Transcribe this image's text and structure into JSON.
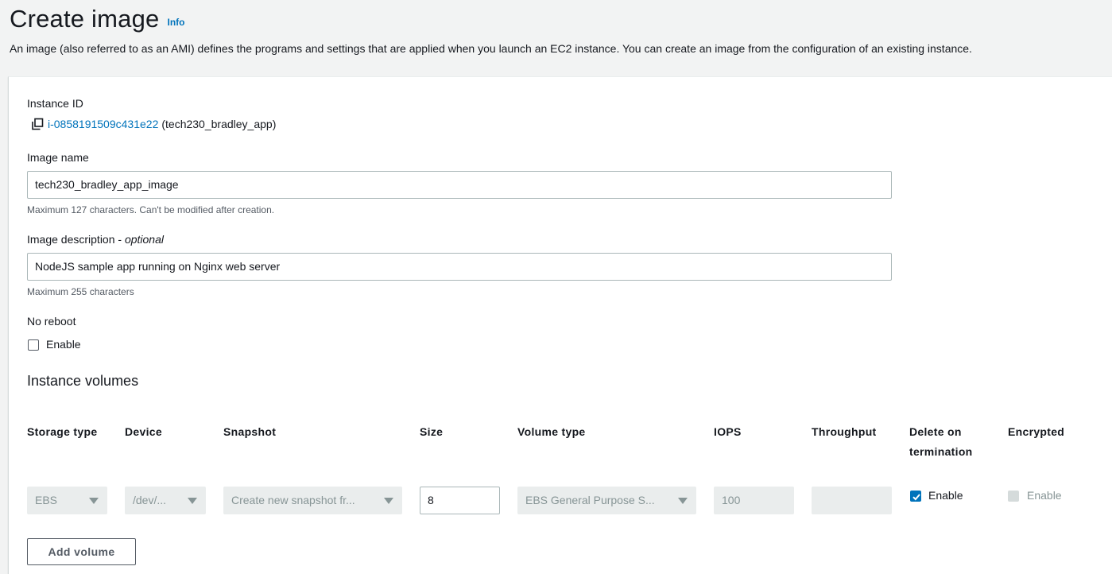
{
  "header": {
    "title": "Create image",
    "info_label": "Info",
    "description": "An image (also referred to as an AMI) defines the programs and settings that are applied when you launch an EC2 instance. You can create an image from the configuration of an existing instance."
  },
  "form": {
    "instance_id": {
      "label": "Instance ID",
      "id": "i-0858191509c431e22",
      "name": "(tech230_bradley_app)"
    },
    "image_name": {
      "label": "Image name",
      "value": "tech230_bradley_app_image",
      "hint": "Maximum 127 characters. Can't be modified after creation."
    },
    "image_description": {
      "label": "Image description - ",
      "optional": "optional",
      "value": "NodeJS sample app running on Nginx web server",
      "hint": "Maximum 255 characters"
    },
    "no_reboot": {
      "label": "No reboot",
      "checkbox_label": "Enable",
      "checked": false
    }
  },
  "volumes": {
    "title": "Instance volumes",
    "columns": [
      "Storage type",
      "Device",
      "Snapshot",
      "Size",
      "Volume type",
      "IOPS",
      "Throughput",
      "Delete on termination",
      "Encrypted"
    ],
    "row": {
      "storage_type": "EBS",
      "device": "/dev/...",
      "snapshot": "Create new snapshot fr...",
      "size": "8",
      "volume_type": "EBS General Purpose S...",
      "iops": "100",
      "throughput": "",
      "delete_on_termination_label": "Enable",
      "delete_on_termination": true,
      "encrypted_label": "Enable",
      "encrypted": false
    },
    "add_button": "Add volume"
  },
  "colors": {
    "link": "#0073bb",
    "page_bg": "#f2f3f3",
    "disabled_bg": "#eaeded",
    "text": "#16191f"
  },
  "icons": {
    "copy": "copy-icon",
    "caret": "caret-down-icon",
    "check": "check-icon"
  }
}
